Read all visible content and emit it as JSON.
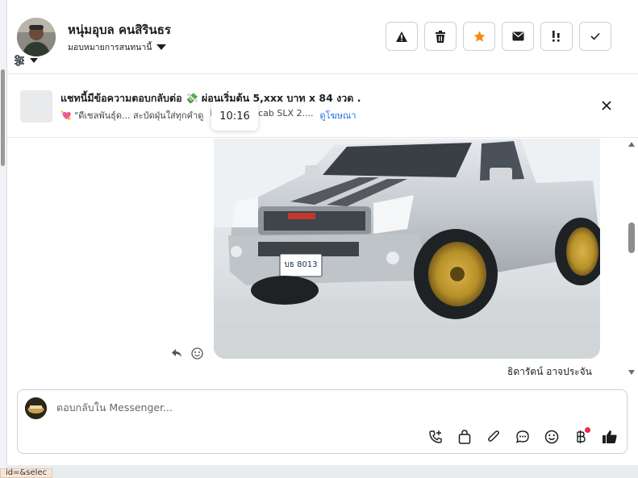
{
  "header": {
    "contact_name": "หนุ่มอุบล คนสิรินธร",
    "assign_label": "มอบหมายการสนทนานี้",
    "actions": [
      {
        "name": "report-spam-button",
        "icon": "warning-icon"
      },
      {
        "name": "delete-button",
        "icon": "trash-icon"
      },
      {
        "name": "star-button",
        "icon": "star-icon"
      },
      {
        "name": "mark-unread-button",
        "icon": "envelope-icon"
      },
      {
        "name": "follow-up-button",
        "icon": "exclamation-icon"
      },
      {
        "name": "mark-done-button",
        "icon": "check-icon"
      }
    ]
  },
  "banner": {
    "title": "แชทนี้มีข้อความตอบกลับต่อ 💸 ผ่อนเริ่มต้น 5,xxx บาท x 84 งวด .",
    "subtitle_prefix": "💘 \"ดีเซลพันธุ์ด... สะบัดฝุ่นใส่ทุกคำดู",
    "subtitle_suffix": "Max Spacecab SLX 2....",
    "ad_link": "ดูโฆษณา",
    "tooltip_time": "10:16"
  },
  "message": {
    "plate_text": "บธ 8013",
    "sender_name": "ธิดารัตน์ อาจประจัน"
  },
  "composer": {
    "placeholder": "ตอบกลับใน Messenger..."
  },
  "status_url": "id=&selec",
  "colors": {
    "accent": "#1b74e4",
    "star": "#f28c13",
    "notification_dot": "#f0284a"
  }
}
